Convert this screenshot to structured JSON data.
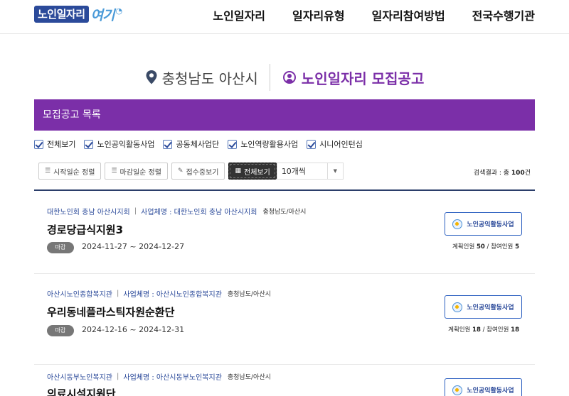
{
  "header": {
    "logo_main": "노인일자리",
    "logo_sub": "여기",
    "nav": [
      "노인일자리",
      "일자리유형",
      "일자리참여방법",
      "전국수행기관"
    ]
  },
  "titlebar": {
    "region": "충청남도 아산시",
    "board_title": "노인일자리 모집공고"
  },
  "list_header": "모집공고 목록",
  "filters": [
    {
      "label": "전체보기",
      "checked": true
    },
    {
      "label": "노인공익활동사업",
      "checked": true
    },
    {
      "label": "공동체사업단",
      "checked": true
    },
    {
      "label": "노인역량활용사업",
      "checked": true
    },
    {
      "label": "시니어인턴십",
      "checked": true
    }
  ],
  "sort": {
    "buttons": [
      "시작일순 정렬",
      "마감일순 정렬",
      "접수중보기",
      "전체보기"
    ],
    "active": "전체보기",
    "page_size": "10개씩"
  },
  "result": {
    "prefix": "검색결과 : 총 ",
    "count": "100",
    "suffix": "건"
  },
  "items": [
    {
      "org": "대한노인회 충남 아산시지회",
      "biz_label": "사업체명 : 대한노인회 충남 아산시지회",
      "region": "충청남도/아산시",
      "title": "경로당급식지원3",
      "status": "마감",
      "period": "2024-11-27 ~ 2024-12-27",
      "type": "노인공익활동사업",
      "plan_label": "계획인원",
      "plan": "50",
      "join_label": "참여인원",
      "join": "5"
    },
    {
      "org": "아산시노인종합복지관",
      "biz_label": "사업체명 : 아산시노인종합복지관",
      "region": "충청남도/아산시",
      "title": "우리동네플라스틱자원순환단",
      "status": "마감",
      "period": "2024-12-16 ~ 2024-12-31",
      "type": "노인공익활동사업",
      "plan_label": "계획인원",
      "plan": "18",
      "join_label": "참여인원",
      "join": "18"
    },
    {
      "org": "아산시동부노인복지관",
      "biz_label": "사업체명 : 아산시동부노인복지관",
      "region": "충청남도/아산시",
      "title": "의료시설지원단",
      "type": "노인공익활동사업"
    }
  ],
  "colors": {
    "purple": "#7b2fa8",
    "navy": "#2b4a9a",
    "badge_border": "#2b5fc0"
  }
}
